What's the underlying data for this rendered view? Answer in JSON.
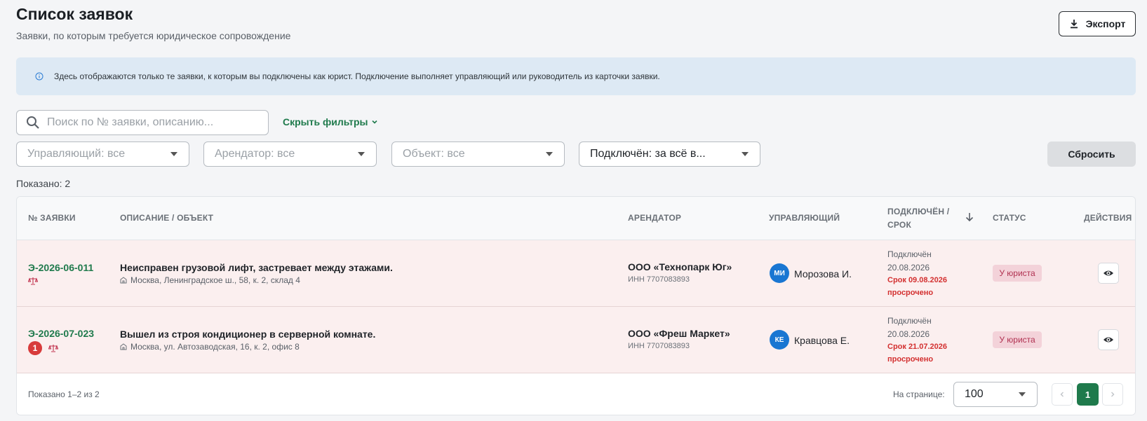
{
  "header": {
    "title": "Список заявок",
    "subtitle": "Заявки, по которым требуется юридическое сопровождение",
    "export_label": "Экспорт"
  },
  "info_banner": {
    "icon": "info-icon",
    "text": "Здесь отображаются только те заявки, к которым вы подключены как юрист. Подключение выполняет управляющий или руководитель из карточки заявки."
  },
  "search": {
    "placeholder": "Поиск по № заявки, описанию...",
    "value": ""
  },
  "filters": {
    "toggle_label": "Скрыть фильтры",
    "manager": "Управляющий: все",
    "tenant": "Арендатор: все",
    "object": "Объект: все",
    "connected": "Подключён: за всё в...",
    "reset_label": "Сбросить"
  },
  "shown_count": "Показано: 2",
  "table": {
    "columns": {
      "number": "№ заявки",
      "description": "Описание / объект",
      "tenant": "Арендатор",
      "manager": "Управляющий",
      "connected_line1": "Подключён /",
      "connected_line2": "срок",
      "status": "Статус",
      "actions": "Действия"
    },
    "rows": [
      {
        "number": "Э-2026-06-011",
        "badge": "",
        "description": "Неисправен грузовой лифт, застревает между этажами.",
        "address": "Москва, Ленинградское ш., 58, к. 2, склад 4",
        "tenant": "ООО «Технопарк Юг»",
        "inn": "ИНН 7707083893",
        "manager_initials": "МИ",
        "manager": "Морозова И.",
        "connected_label": "Подключён",
        "connected_date": "20.08.2026",
        "deadline": "Срок 09.08.2026",
        "overdue": "просрочено",
        "status": "У юриста"
      },
      {
        "number": "Э-2026-07-023",
        "badge": "1",
        "description": "Вышел из строя кондиционер в серверной комнате.",
        "address": "Москва, ул. Автозаводская, 16, к. 2, офис 8",
        "tenant": "ООО «Фреш Маркет»",
        "inn": "ИНН 7707083893",
        "manager_initials": "КЕ",
        "manager": "Кравцова Е.",
        "connected_label": "Подключён",
        "connected_date": "20.08.2026",
        "deadline": "Срок 21.07.2026",
        "overdue": "просрочено",
        "status": "У юриста"
      }
    ]
  },
  "footer": {
    "range": "Показано 1–2 из 2",
    "per_page_label": "На странице:",
    "per_page_value": "100",
    "current_page": "1"
  },
  "colors": {
    "accent": "#1f7a4c",
    "row_overdue_bg": "#fbefef",
    "deadline_red": "#d33030",
    "status_bg": "#f3d2d9",
    "avatar_blue": "#1976d2",
    "banner_bg": "#dde9f4"
  }
}
